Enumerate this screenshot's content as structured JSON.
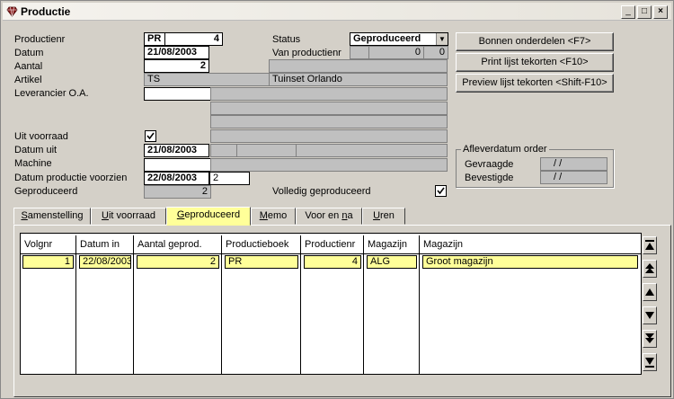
{
  "window": {
    "title": "Productie"
  },
  "labels": {
    "productienr": "Productienr",
    "datum": "Datum",
    "aantal": "Aantal",
    "artikel": "Artikel",
    "leverancier": "Leverancier O.A.",
    "uit_voorraad": "Uit voorraad",
    "datum_uit": "Datum uit",
    "machine": "Machine",
    "datum_productie_voorzien": "Datum productie voorzien",
    "geproduceerd": "Geproduceerd",
    "status": "Status",
    "van_productienr": "Van productienr",
    "volledig_geproduceerd": "Volledig geproduceerd"
  },
  "fields": {
    "productienr_prefix": "PR",
    "productienr_value": "4",
    "datum": "21/08/2003",
    "aantal": "2",
    "artikel_code": "TS",
    "artikel_name": "Tuinset Orlando",
    "datum_uit": "21/08/2003",
    "datum_productie_voorzien": "22/08/2003",
    "datum_productie_voorzien_extra": "2",
    "geproduceerd": "2",
    "status": "Geproduceerd",
    "van_productienr_a": "0",
    "van_productienr_b": "0"
  },
  "checks": {
    "uit_voorraad": true,
    "volledig_geproduceerd": true
  },
  "buttons": {
    "bonnen": "Bonnen onderdelen <F7>",
    "print": "Print lijst tekorten <F10>",
    "preview": "Preview lijst tekorten <Shift-F10>"
  },
  "afleverdatum": {
    "title": "Afleverdatum order",
    "gevraagde_label": "Gevraagde",
    "gevraagde_value": "/ /",
    "bevestigde_label": "Bevestigde",
    "bevestigde_value": "/ /"
  },
  "tabs": [
    {
      "pre": "",
      "ul": "S",
      "post": "amenstelling"
    },
    {
      "pre": "",
      "ul": "U",
      "post": "it voorraad"
    },
    {
      "pre": "",
      "ul": "G",
      "post": "eproduceerd"
    },
    {
      "pre": "",
      "ul": "M",
      "post": "emo"
    },
    {
      "pre": "Voor en ",
      "ul": "n",
      "post": "a"
    },
    {
      "pre": "",
      "ul": "U",
      "post": "ren"
    }
  ],
  "grid": {
    "headers": [
      "Volgnr",
      "Datum in",
      "Aantal geprod.",
      "Productieboek",
      "Productienr",
      "Magazijn",
      "Magazijn"
    ],
    "row": [
      "1",
      "22/08/2003",
      "2",
      "PR",
      "4",
      "ALG",
      "Groot magazijn"
    ]
  }
}
